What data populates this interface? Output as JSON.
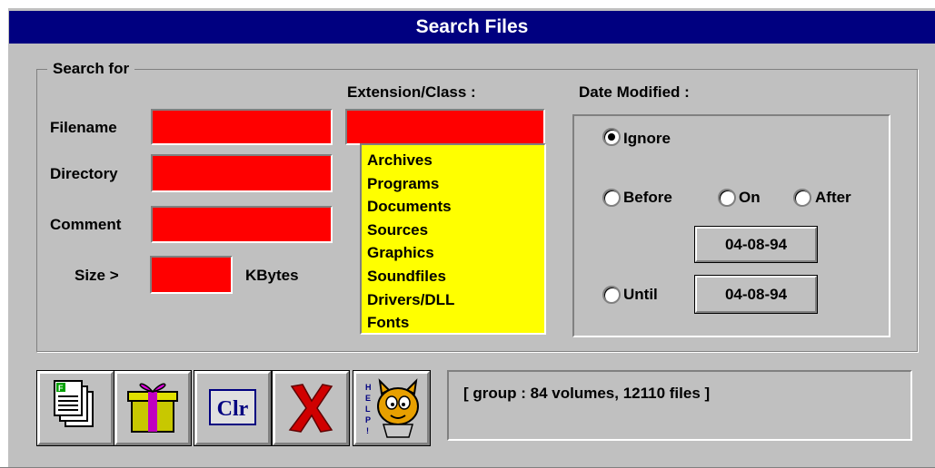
{
  "window": {
    "title": "Search Files"
  },
  "search_group": {
    "legend": "Search for",
    "filename_label": "Filename",
    "filename_value": "",
    "directory_label": "Directory",
    "directory_value": "",
    "comment_label": "Comment",
    "comment_value": "",
    "size_label": "Size >",
    "size_value": "",
    "size_unit": "KBytes"
  },
  "extension": {
    "label": "Extension/Class :",
    "value": "",
    "classes": [
      "Archives",
      "Programs",
      "Documents",
      "Sources",
      "Graphics",
      "Soundfiles",
      "Drivers/DLL",
      "Fonts"
    ]
  },
  "date_modified": {
    "label": "Date Modified :",
    "ignore": "Ignore",
    "before": "Before",
    "on": "On",
    "after": "After",
    "until": "Until",
    "date_value": "04-08-94",
    "until_value": "04-08-94",
    "selected": "Ignore"
  },
  "toolbar": {
    "clear_label": "Clr",
    "help_label": "HELP!"
  },
  "status": {
    "text": "[ group : 84 volumes, 12110 files ]"
  },
  "colors": {
    "field_bg": "#ff0000",
    "list_bg": "#ffff00",
    "title_bg": "#000080",
    "window_bg": "#c0c0c0"
  }
}
